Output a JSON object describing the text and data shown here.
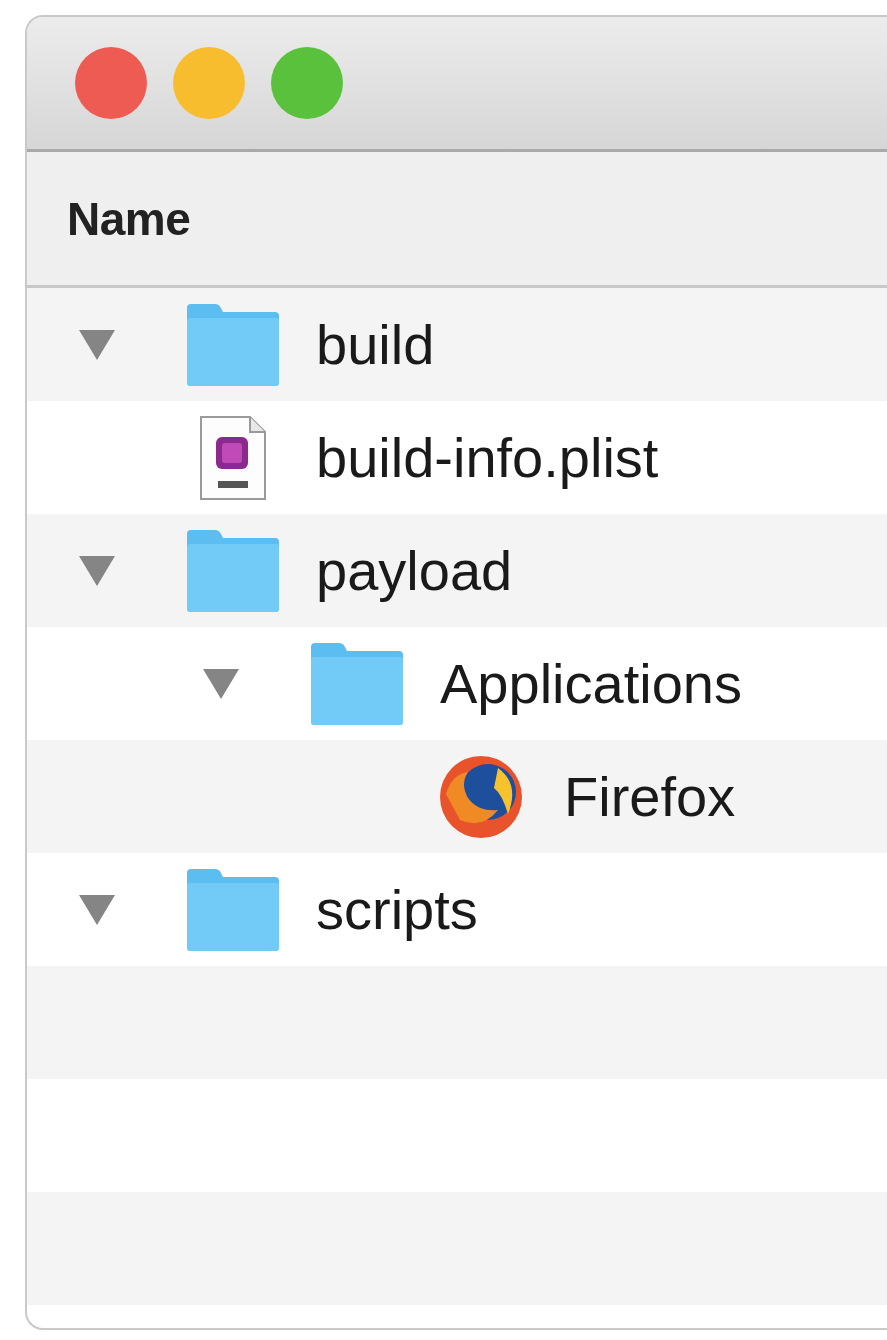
{
  "window": {
    "traffic_lights": [
      {
        "color": "#ee5b52"
      },
      {
        "color": "#f7bd2f"
      },
      {
        "color": "#5ac13d"
      }
    ]
  },
  "table": {
    "columns": [
      "Name"
    ],
    "rows": [
      {
        "name": "build",
        "kind": "folder",
        "expanded": true
      },
      {
        "name": "build-info.plist",
        "kind": "document"
      },
      {
        "name": "payload",
        "kind": "folder",
        "expanded": true,
        "children": [
          {
            "name": "Applications",
            "kind": "folder",
            "expanded": true,
            "children": [
              {
                "name": "Firefox",
                "kind": "app"
              }
            ]
          }
        ]
      },
      {
        "name": "scripts",
        "kind": "folder",
        "expanded": true
      }
    ]
  }
}
